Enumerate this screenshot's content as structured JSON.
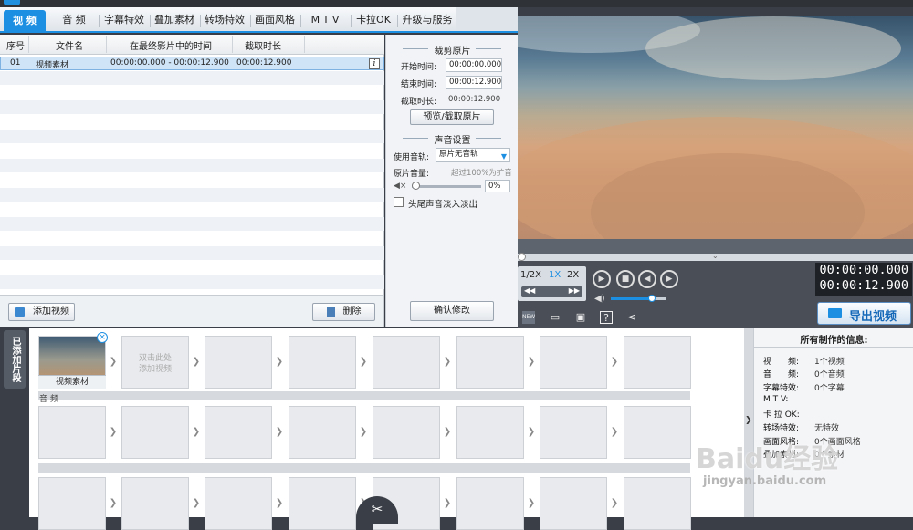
{
  "tabs": [
    {
      "label": "视 频",
      "active": true
    },
    {
      "label": "音 频"
    },
    {
      "label": "字幕特效"
    },
    {
      "label": "叠加素材"
    },
    {
      "label": "转场特效"
    },
    {
      "label": "画面风格"
    },
    {
      "label": "M T V"
    },
    {
      "label": "卡拉OK"
    },
    {
      "label": "升级与服务"
    }
  ],
  "filelist": {
    "headers": [
      "序号",
      "文件名",
      "在最终影片中的时间",
      "截取时长"
    ],
    "rows": [
      {
        "index": "01",
        "name": "视频素材",
        "time": "00:00:00.000 - 00:00:12.900",
        "duration": "00:00:12.900",
        "info": "i"
      }
    ],
    "add_button": "添加视频",
    "delete_button": "删除"
  },
  "trim": {
    "title": "裁剪原片",
    "start_label": "开始时间:",
    "start_value": "00:00:00.000",
    "end_label": "结束时间:",
    "end_value": "00:00:12.900",
    "duration_label": "截取时长:",
    "duration_value": "00:00:12.900",
    "preview_button": "预览/截取原片"
  },
  "sound": {
    "title": "声音设置",
    "track_label": "使用音轨:",
    "track_value": "原片无音轨",
    "volume_label": "原片音量:",
    "volume_hint": "超过100%为扩音",
    "volume_value": "0%",
    "volume_level": 0,
    "fade_label": "头尾声音淡入淡出",
    "confirm_button": "确认修改"
  },
  "player": {
    "speed_half": "1/2X",
    "speed_1": "1X",
    "speed_2": "2X",
    "current_time": "00:00:00.000",
    "total_time": "00:00:12.900",
    "export_button": "导出视频",
    "volume_level": 0.75,
    "progress": 0,
    "icons": [
      "new-icon",
      "folder-icon",
      "save-icon",
      "help-icon",
      "share-icon"
    ]
  },
  "timeline": {
    "side_label": "已添加片段",
    "clip_label": "视频素材",
    "empty_hint": "双击此处 添加视频",
    "audio_label": "音 频"
  },
  "info": {
    "title": "所有制作的信息:",
    "items": [
      {
        "key": "视　　频:",
        "value": "1个视频"
      },
      {
        "key": "音　　频:",
        "value": "0个音频"
      },
      {
        "key": "字幕特效:",
        "value": "0个字幕"
      },
      {
        "key": "M  T  V:",
        "value": ""
      },
      {
        "key": "卡 拉 OK:",
        "value": ""
      },
      {
        "key": "转场特效:",
        "value": "无特效"
      },
      {
        "key": "画面风格:",
        "value": "0个画面风格"
      },
      {
        "key": "叠加素材:",
        "value": "0个素材"
      }
    ]
  },
  "watermark": {
    "main": "Baidu经验",
    "sub": "jingyan.baidu.com"
  },
  "colors": {
    "accent": "#1d8fe2",
    "panel_dark": "#3a3f47",
    "selected_row": "#cfe4f7"
  }
}
